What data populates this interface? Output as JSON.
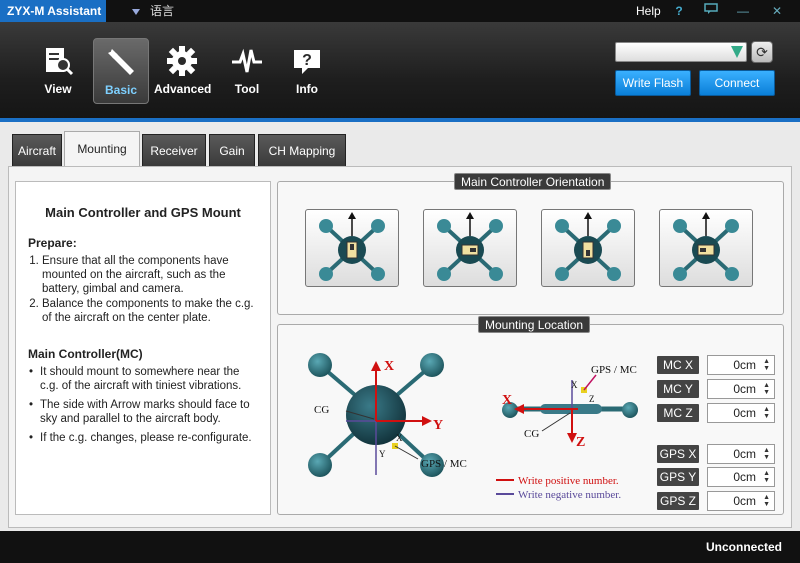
{
  "window": {
    "title": "ZYX-M Assistant",
    "language_menu": "语言",
    "help_label": "Help",
    "help_icon": "?",
    "chat_icon": "message-icon",
    "minimize_icon": "—",
    "close_icon": "✕"
  },
  "toolbar": {
    "nav": [
      {
        "label": "View",
        "icon": "view-document-icon"
      },
      {
        "label": "Basic",
        "icon": "wrench-icon"
      },
      {
        "label": "Advanced",
        "icon": "gear-icon"
      },
      {
        "label": "Tool",
        "icon": "pulse-icon"
      },
      {
        "label": "Info",
        "icon": "info-bubble-icon"
      }
    ],
    "port_select_value": "",
    "refresh_icon": "⟳",
    "write_flash_label": "Write Flash",
    "connect_label": "Connect"
  },
  "tabs": [
    "Aircraft",
    "Mounting",
    "Receiver",
    "Gain",
    "CH Mapping"
  ],
  "active_tab": "Mounting",
  "info": {
    "title": "Main Controller and GPS Mount",
    "prepare_heading": "Prepare:",
    "prepare_items": [
      "Ensure that all the components have mounted on the aircraft, such as the battery, gimbal and camera.",
      "Balance the components to make the c.g. of the aircraft on the center plate."
    ],
    "mc_heading": "Main Controller(MC)",
    "mc_items": [
      "It should mount to somewhere near the c.g. of the aircraft with tiniest vibrations.",
      "The side with Arrow marks should face to sky and parallel to the aircraft body.",
      "If the c.g. changes, please re-configurate."
    ]
  },
  "orientation": {
    "title": "Main Controller Orientation"
  },
  "location": {
    "title": "Mounting Location",
    "diagram": {
      "top_x": "X",
      "top_y": "Y",
      "top_cg": "CG",
      "top_small_x": "X",
      "top_small_y": "Y",
      "top_gps": "GPS / MC",
      "side_x": "X",
      "side_z": "Z",
      "side_cg": "CG",
      "side_small_x": "X",
      "side_small_z": "Z",
      "side_gps": "GPS / MC",
      "legend_positive": "Write positive number.",
      "legend_negative": "Write negative number.",
      "positive_color": "#d01010",
      "negative_color": "#5a4a9a"
    },
    "fields": [
      {
        "label": "MC X",
        "value": "0cm"
      },
      {
        "label": "MC Y",
        "value": "0cm"
      },
      {
        "label": "MC Z",
        "value": "0cm"
      },
      {
        "label": "GPS X",
        "value": "0cm"
      },
      {
        "label": "GPS Y",
        "value": "0cm"
      },
      {
        "label": "GPS Z",
        "value": "0cm"
      }
    ]
  },
  "status": {
    "text": "Unconnected"
  }
}
